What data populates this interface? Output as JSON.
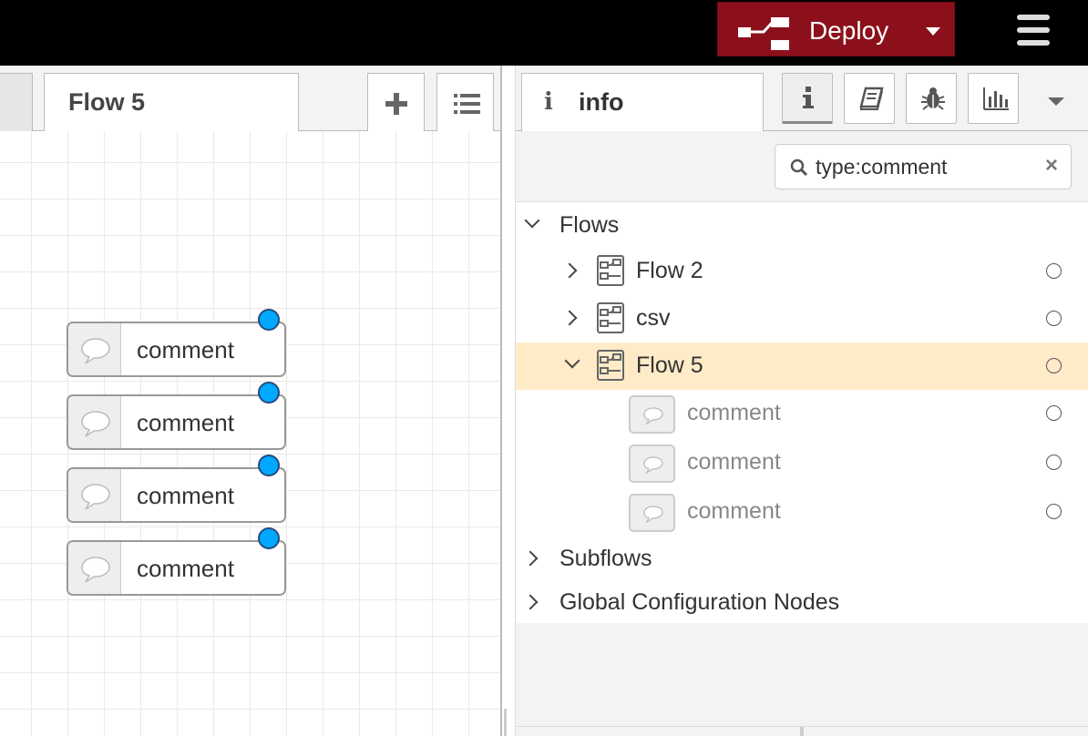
{
  "header": {
    "deploy_label": "Deploy",
    "deploy_color": "#8c101c"
  },
  "workspace": {
    "active_tab": "Flow 5",
    "add_flow_icon": "plus-icon",
    "flow_list_icon": "list-icon",
    "nodes": [
      {
        "label": "comment",
        "icon": "speech-bubble-icon"
      },
      {
        "label": "comment",
        "icon": "speech-bubble-icon"
      },
      {
        "label": "comment",
        "icon": "speech-bubble-icon"
      },
      {
        "label": "comment",
        "icon": "speech-bubble-icon"
      }
    ]
  },
  "sidebar": {
    "tab_icon": "i",
    "tab_label": "info",
    "buttons": [
      "info-icon",
      "book-icon",
      "bug-icon",
      "bar-chart-icon"
    ],
    "search": {
      "value": "type:comment",
      "clear_icon": "×"
    },
    "tree": {
      "flows_label": "Flows",
      "flows": [
        {
          "label": "Flow 2",
          "expanded": false
        },
        {
          "label": "csv",
          "expanded": false
        },
        {
          "label": "Flow 5",
          "expanded": true,
          "selected": true
        }
      ],
      "children": [
        "comment",
        "comment",
        "comment"
      ],
      "subflows_label": "Subflows",
      "global_label": "Global Configuration Nodes"
    },
    "selected_color": "#ffebc8"
  }
}
